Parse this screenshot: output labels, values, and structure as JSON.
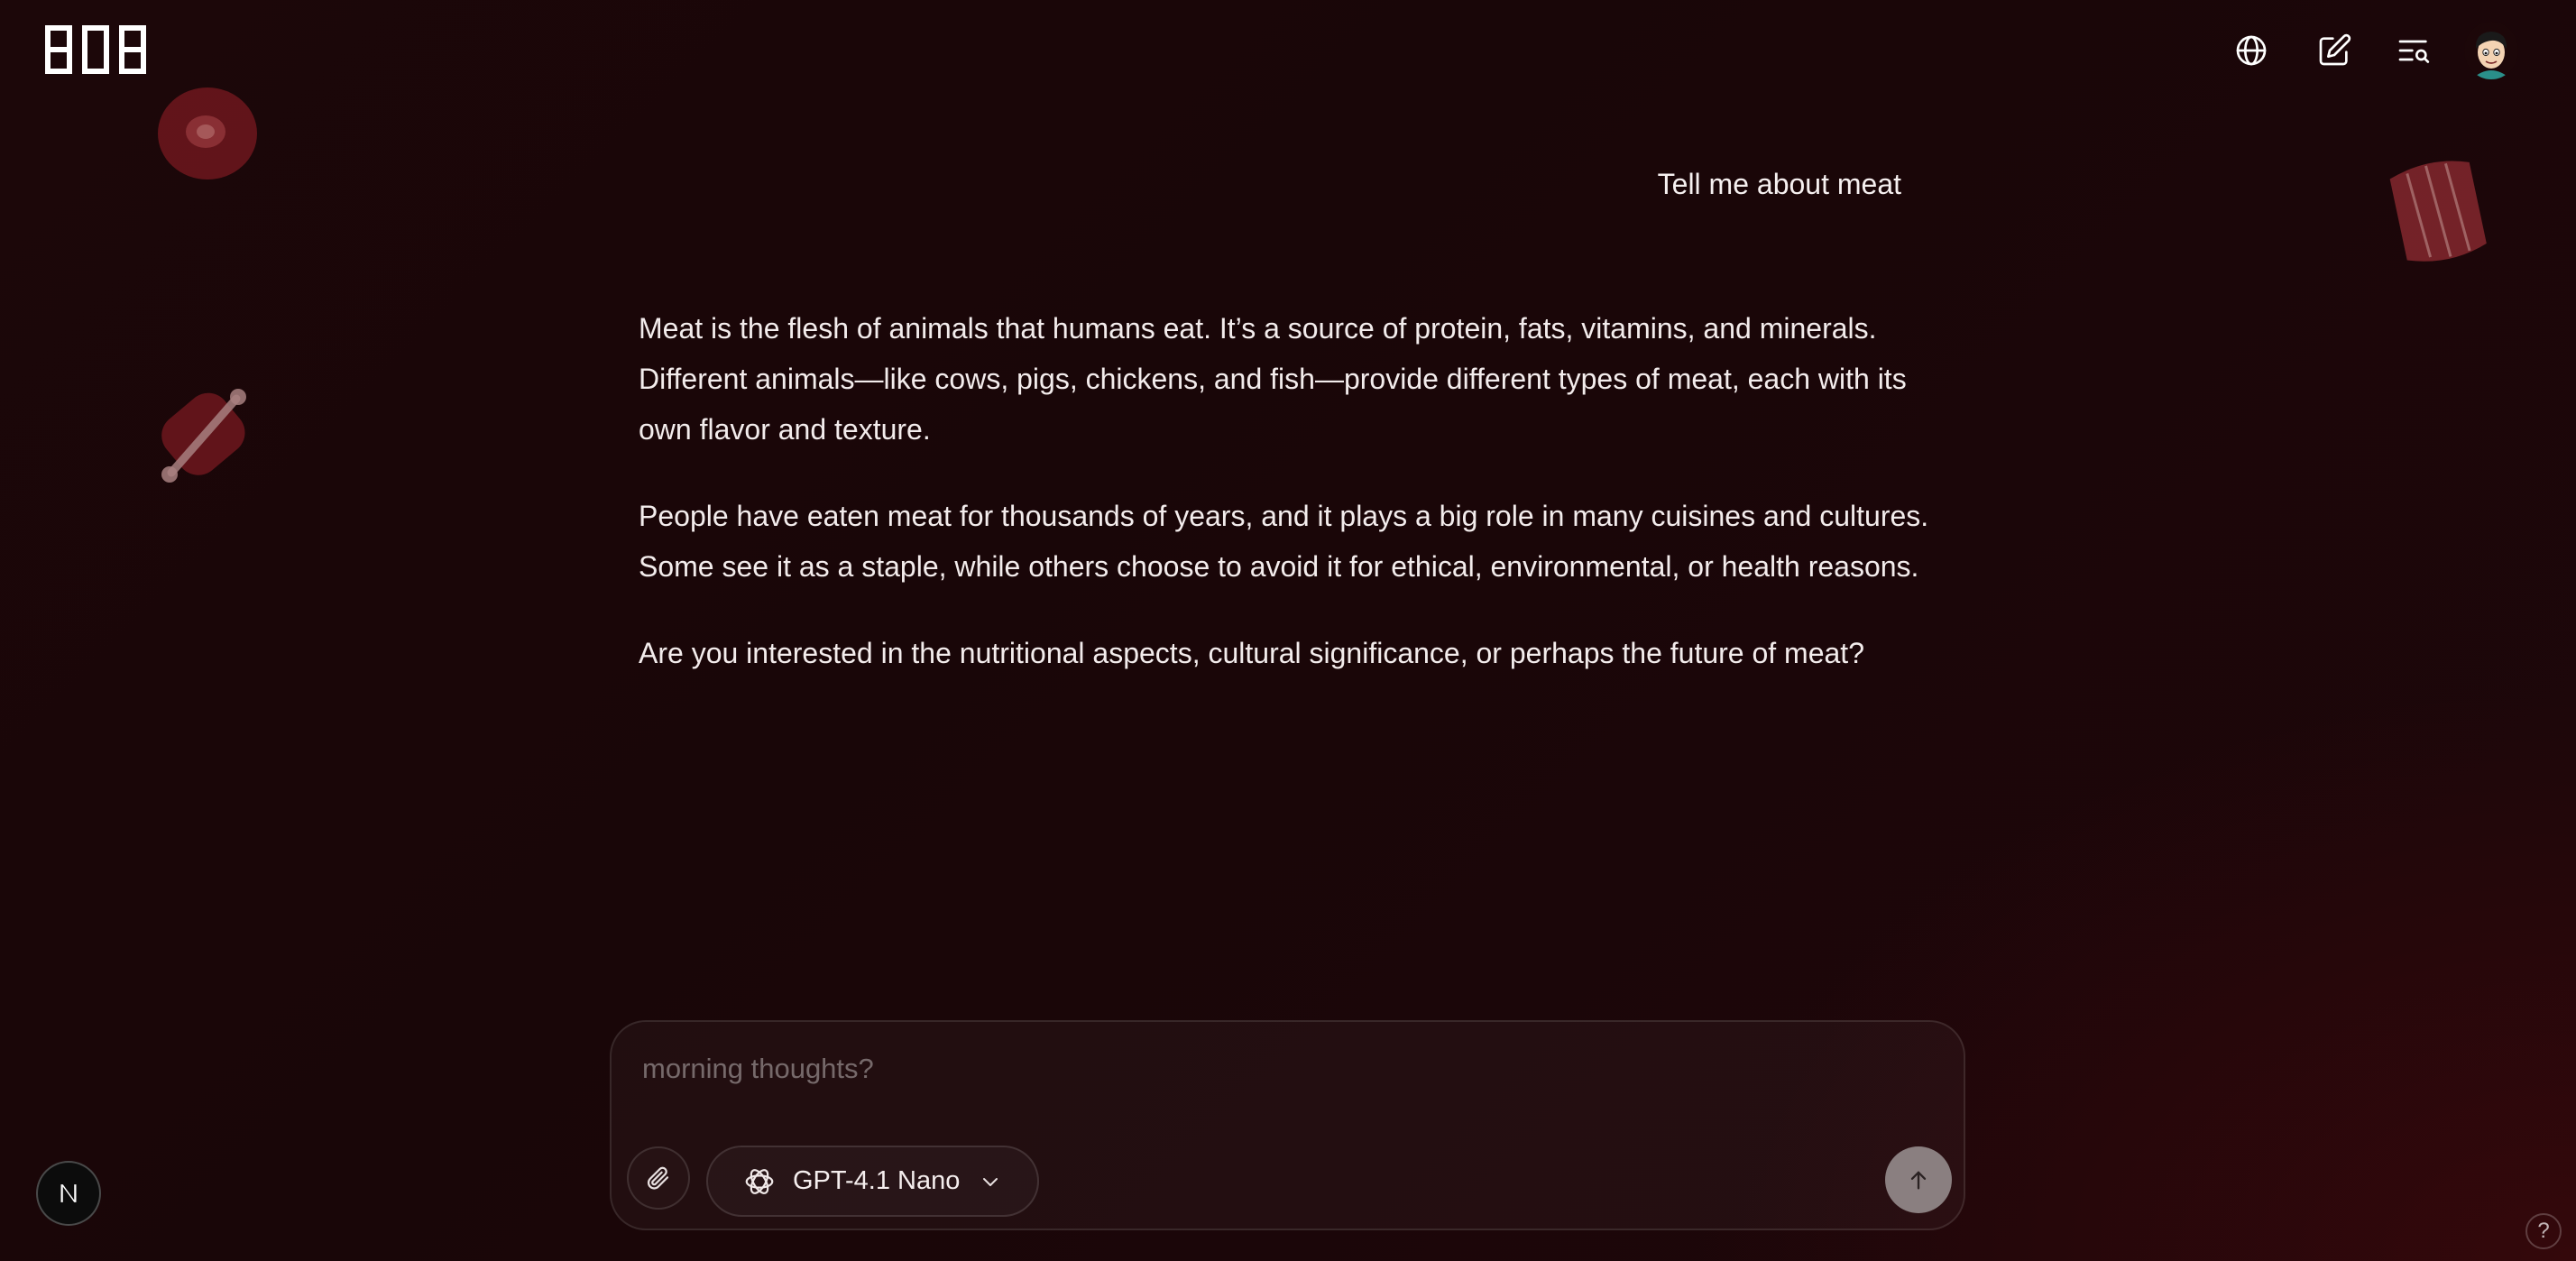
{
  "header": {
    "logo_text": "BOB",
    "icons": [
      "globe-icon",
      "new-chat-icon",
      "search-history-icon",
      "user-avatar"
    ]
  },
  "conversation": {
    "user_message": "Tell me about meat",
    "assistant_paragraphs": [
      "Meat is the flesh of animals that humans eat. It’s a source of protein, fats, vitamins, and minerals. Different animals—like cows, pigs, chickens, and fish—provide different types of meat, each with its own flavor and texture.",
      "People have eaten meat for thousands of years, and it plays a big role in many cuisines and cultures. Some see it as a staple, while others choose to avoid it for ethical, environmental, or health reasons.",
      "Are you interested in the nutritional aspects, cultural significance, or perhaps the future of meat?"
    ]
  },
  "composer": {
    "placeholder": "morning thoughts?",
    "value": "",
    "model_label": "GPT-4.1 Nano"
  },
  "badge": {
    "letter": "N"
  },
  "help": {
    "label": "?"
  },
  "colors": {
    "background": "#1a0608",
    "text": "#f3ecec",
    "send_button": "#8a7f80",
    "deco_meat": "#7a1a20"
  }
}
